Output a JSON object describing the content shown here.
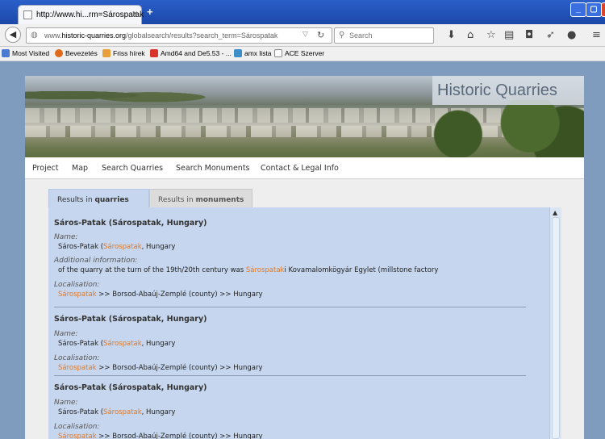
{
  "browser": {
    "tab_title": "http://www.hi...rm=Sárospatak",
    "tab_close": "×",
    "new_tab": "+",
    "win_min": "_",
    "win_max": "▢",
    "win_close": "X",
    "url_prefix": "www.",
    "url_domain": "historic-quarries.org",
    "url_path": "/globalsearch/results?search_term=Sárospatak",
    "search_placeholder": "Search",
    "bookmarks": [
      "Most Visited",
      "Bevezetés",
      "Friss hírek",
      "Amd64 and De5.53 - ...",
      "amx lista",
      "ACE Szerver"
    ]
  },
  "site": {
    "title": "Historic Quarries",
    "menu": [
      "Project",
      "Map",
      "Search Quarries",
      "Search Monuments",
      "Contact & Legal Info"
    ]
  },
  "tabs": {
    "quarries_prefix": "Results in ",
    "quarries_bold": "quarries",
    "monuments_prefix": "Results in ",
    "monuments_bold": "monuments"
  },
  "labels": {
    "name": "Name:",
    "additional": "Additional information:",
    "localisation": "Localisation:"
  },
  "results": [
    {
      "heading": "Sáros-Patak (Sárospatak, Hungary)",
      "name_a": "Sáros-Patak (",
      "name_hl": "Sárospatak",
      "name_b": ", Hungary",
      "info_a": "of the quarry at the turn of the 19th/20th century was ",
      "info_hl": "Sárospatak",
      "info_b": "i Kovamalomkögyár Egylet (millstone factory",
      "loc_hl": "Sárospatak",
      "loc_b": " >> Borsod-Abaúj-Zemplé (county) >> Hungary"
    },
    {
      "heading": "Sáros-Patak (Sárospatak, Hungary)",
      "name_a": "Sáros-Patak (",
      "name_hl": "Sárospatak",
      "name_b": ", Hungary",
      "loc_hl": "Sárospatak",
      "loc_b": " >> Borsod-Abaúj-Zemplé (county) >> Hungary"
    },
    {
      "heading": "Sáros-Patak (Sárospatak, Hungary)",
      "name_a": "Sáros-Patak (",
      "name_hl": "Sárospatak",
      "name_b": ", Hungary",
      "loc_hl": "Sárospatak",
      "loc_b": " >> Borsod-Abaúj-Zemplé (county) >> Hungary"
    }
  ],
  "colors": {
    "accent_highlight": "#e07a2a",
    "panel_bg": "#c5d6ee",
    "titlebar": "#2a5fc9"
  }
}
